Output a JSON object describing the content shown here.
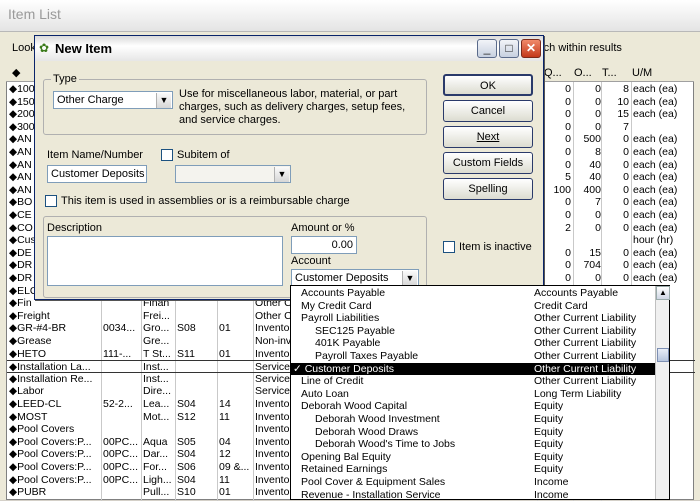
{
  "background": {
    "window_title": "Item List",
    "look_label": "Look",
    "search_within_label": "rch within results",
    "columns": {
      "diamond": "◆",
      "q1": "Q...",
      "o": "O...",
      "t": "T...",
      "um": "U/M"
    },
    "rows": [
      {
        "name": "◆100",
        "c5": "0",
        "c6": "0",
        "c7": "8",
        "um": "each (ea)"
      },
      {
        "name": "◆150",
        "c5": "0",
        "c6": "0",
        "c7": "10",
        "um": "each (ea)"
      },
      {
        "name": "◆200",
        "c5": "0",
        "c6": "0",
        "c7": "15",
        "um": "each (ea)"
      },
      {
        "name": "◆300",
        "c5": "0",
        "c6": "0",
        "c7": "7",
        "um": ""
      },
      {
        "name": "◆AN",
        "c5": "0",
        "c6": "500",
        "c7": "0",
        "um": "each (ea)"
      },
      {
        "name": "◆AN",
        "c5": "0",
        "c6": "8",
        "c7": "0",
        "um": "each (ea)"
      },
      {
        "name": "◆AN",
        "c5": "0",
        "c6": "40",
        "c7": "0",
        "um": "each (ea)"
      },
      {
        "name": "◆AN",
        "c5": "5",
        "c6": "40",
        "c7": "0",
        "um": "each (ea)"
      },
      {
        "name": "◆AN",
        "c5": "100",
        "c6": "400",
        "c7": "0",
        "um": "each (ea)"
      },
      {
        "name": "◆BO",
        "c5": "0",
        "c6": "7",
        "c7": "0",
        "um": "each (ea)"
      },
      {
        "name": "◆CE",
        "c5": "0",
        "c6": "0",
        "c7": "0",
        "um": "each (ea)"
      },
      {
        "name": "◆CO",
        "c5": "2",
        "c6": "0",
        "c7": "0",
        "um": "each (ea)"
      },
      {
        "name": "◆Cus",
        "c5": "",
        "c6": "",
        "c7": "",
        "um": "hour (hr)"
      },
      {
        "name": "◆DE",
        "c5": "0",
        "c6": "15",
        "c7": "0",
        "um": "each (ea)"
      },
      {
        "name": "◆DR",
        "c5": "0",
        "c6": "704",
        "c7": "0",
        "um": "each (ea)"
      },
      {
        "name": "◆DR",
        "c5": "0",
        "c6": "0",
        "c7": "0",
        "um": "each (ea)"
      },
      {
        "name": "◆ELO",
        "c5": "",
        "c6": "",
        "c7": "",
        "um": ""
      },
      {
        "name": "◆Fin",
        "c2": "",
        "c3": "Finan",
        "c4": "",
        "c4b": "",
        "type": "Other C",
        "um": ""
      },
      {
        "name": "◆Freight",
        "c2": "",
        "c3": "Frei...",
        "c4": "",
        "c4b": "",
        "type": "Other C",
        "um": ""
      },
      {
        "name": "◆GR-#4-BR",
        "c2": "0034...",
        "c3": "Gro...",
        "c4": "S08",
        "c4b": "01",
        "type": "Invento",
        "um": ""
      },
      {
        "name": "◆Grease",
        "c2": "",
        "c3": "Gre...",
        "c4": "",
        "c4b": "",
        "type": "Non-inv",
        "um": ""
      },
      {
        "name": "◆HETO",
        "c2": "111-...",
        "c3": "T St...",
        "c4": "S11",
        "c4b": "01",
        "type": "Invento",
        "um": ""
      },
      {
        "name": "◆Installation La...",
        "c2": "",
        "c3": "Inst...",
        "c4": "",
        "c4b": "",
        "type": "Service",
        "um": ""
      },
      {
        "name": "◆Installation Re...",
        "c2": "",
        "c3": "Inst...",
        "c4": "",
        "c4b": "",
        "type": "Service",
        "um": ""
      },
      {
        "name": "◆Labor",
        "c2": "",
        "c3": "Dire...",
        "c4": "",
        "c4b": "",
        "type": "Service",
        "um": ""
      },
      {
        "name": "◆LEED-CL",
        "c2": "52-2...",
        "c3": "Lea...",
        "c4": "S04",
        "c4b": "14",
        "type": "Invento",
        "um": ""
      },
      {
        "name": "◆MOST",
        "c2": "",
        "c3": "Mot...",
        "c4": "S12",
        "c4b": "11",
        "type": "Invento",
        "um": ""
      },
      {
        "name": "◆Pool Covers",
        "c2": "",
        "c3": "",
        "c4": "",
        "c4b": "",
        "type": "Invento",
        "um": ""
      },
      {
        "name": "◆Pool Covers:P...",
        "c2": "00PC...",
        "c3": "Aqua",
        "c4": "S05",
        "c4b": "04",
        "type": "Invento",
        "um": ""
      },
      {
        "name": "◆Pool Covers:P...",
        "c2": "00PC...",
        "c3": "Dar...",
        "c4": "S04",
        "c4b": "12",
        "type": "Invento",
        "um": ""
      },
      {
        "name": "◆Pool Covers:P...",
        "c2": "00PC...",
        "c3": "For...",
        "c4": "S06",
        "c4b": "09 &...",
        "type": "Invento",
        "um": ""
      },
      {
        "name": "◆Pool Covers:P...",
        "c2": "00PC...",
        "c3": "Ligh...",
        "c4": "S04",
        "c4b": "11",
        "type": "Invento",
        "um": ""
      },
      {
        "name": "◆PUBR",
        "c2": "",
        "c3": "Pull...",
        "c4": "S10",
        "c4b": "01",
        "type": "Invento",
        "um": ""
      }
    ]
  },
  "dialog": {
    "title": "New Item",
    "type_group_label": "Type",
    "type_value": "Other Charge",
    "type_description": "Use for miscellaneous labor, material, or part charges, such as delivery charges, setup fees, and service charges.",
    "item_name_label": "Item Name/Number",
    "item_name_value": "Customer Deposits",
    "subitem_label": "Subitem of",
    "assembly_checkbox_label": "This item is used in assemblies or is a reimbursable charge",
    "description_label": "Description",
    "amount_label": "Amount or %",
    "amount_value": "0.00",
    "account_label": "Account",
    "account_value": "Customer Deposits",
    "inactive_label": "Item is inactive",
    "buttons": {
      "ok": "OK",
      "cancel": "Cancel",
      "next": "Next",
      "custom_fields": "Custom Fields",
      "spelling": "Spelling"
    },
    "window_buttons": {
      "minimize": "_",
      "maximize": "□",
      "close": "✕"
    }
  },
  "account_dropdown": {
    "items": [
      {
        "name": "Accounts Payable",
        "type": "Accounts Payable",
        "indent": 0
      },
      {
        "name": "My Credit Card",
        "type": "Credit Card",
        "indent": 0
      },
      {
        "name": "Payroll Liabilities",
        "type": "Other Current Liability",
        "indent": 0
      },
      {
        "name": "SEC125 Payable",
        "type": "Other Current Liability",
        "indent": 1
      },
      {
        "name": "401K Payable",
        "type": "Other Current Liability",
        "indent": 1
      },
      {
        "name": "Payroll Taxes Payable",
        "type": "Other Current Liability",
        "indent": 1
      },
      {
        "name": "✓ Customer Deposits",
        "type": "Other Current Liability",
        "indent": 0,
        "selected": true
      },
      {
        "name": "Line of Credit",
        "type": "Other Current Liability",
        "indent": 0
      },
      {
        "name": "Auto Loan",
        "type": "Long Term Liability",
        "indent": 0
      },
      {
        "name": "Deborah Wood Capital",
        "type": "Equity",
        "indent": 0
      },
      {
        "name": "Deborah Wood Investment",
        "type": "Equity",
        "indent": 1
      },
      {
        "name": "Deborah Wood Draws",
        "type": "Equity",
        "indent": 1
      },
      {
        "name": "Deborah Wood's Time to Jobs",
        "type": "Equity",
        "indent": 1
      },
      {
        "name": "Opening Bal Equity",
        "type": "Equity",
        "indent": 0
      },
      {
        "name": "Retained Earnings",
        "type": "Equity",
        "indent": 0
      },
      {
        "name": "Pool Cover & Equipment Sales",
        "type": "Income",
        "indent": 0
      },
      {
        "name": "Revenue - Installation Service",
        "type": "Income",
        "indent": 0
      }
    ]
  }
}
